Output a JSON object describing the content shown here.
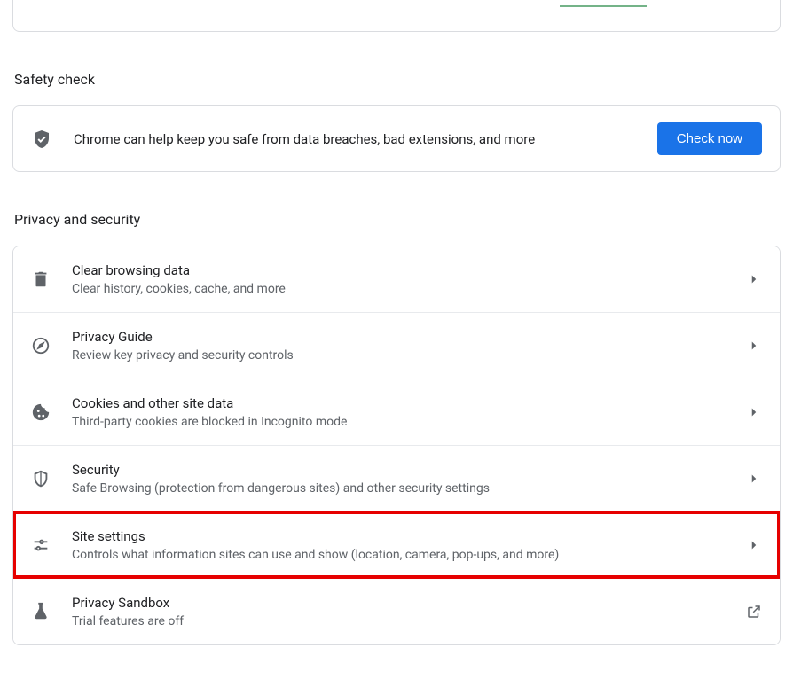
{
  "safety": {
    "section_title": "Safety check",
    "text": "Chrome can help keep you safe from data breaches, bad extensions, and more",
    "button": "Check now"
  },
  "privacy": {
    "section_title": "Privacy and security",
    "items": [
      {
        "title": "Clear browsing data",
        "sub": "Clear history, cookies, cache, and more",
        "icon": "trash",
        "action": "arrow"
      },
      {
        "title": "Privacy Guide",
        "sub": "Review key privacy and security controls",
        "icon": "compass",
        "action": "arrow"
      },
      {
        "title": "Cookies and other site data",
        "sub": "Third-party cookies are blocked in Incognito mode",
        "icon": "cookie",
        "action": "arrow"
      },
      {
        "title": "Security",
        "sub": "Safe Browsing (protection from dangerous sites) and other security settings",
        "icon": "shield",
        "action": "arrow"
      },
      {
        "title": "Site settings",
        "sub": "Controls what information sites can use and show (location, camera, pop-ups, and more)",
        "icon": "tune",
        "action": "arrow",
        "highlighted": true
      },
      {
        "title": "Privacy Sandbox",
        "sub": "Trial features are off",
        "icon": "flask",
        "action": "external"
      }
    ]
  }
}
